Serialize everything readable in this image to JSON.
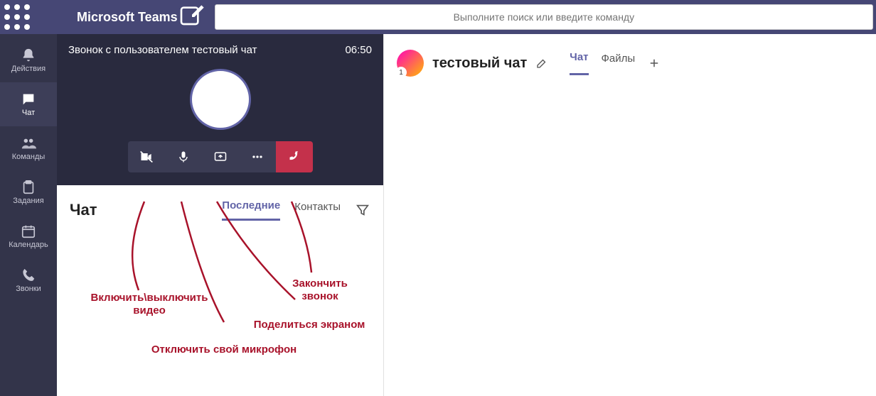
{
  "app": {
    "title": "Microsoft Teams"
  },
  "search": {
    "placeholder": "Выполните поиск или введите команду"
  },
  "rail": {
    "items": [
      {
        "label": "Действия",
        "icon": "bell"
      },
      {
        "label": "Чат",
        "icon": "chat",
        "active": true
      },
      {
        "label": "Команды",
        "icon": "teams"
      },
      {
        "label": "Задания",
        "icon": "assignments"
      },
      {
        "label": "Календарь",
        "icon": "calendar"
      },
      {
        "label": "Звонки",
        "icon": "calls"
      }
    ]
  },
  "call": {
    "title": "Звонок с пользователем тестовый чат",
    "duration": "06:50",
    "buttons": [
      "camera-off",
      "mic",
      "share-screen",
      "more",
      "hangup"
    ]
  },
  "chatlist": {
    "title": "Чат",
    "tabs": [
      {
        "label": "Последние",
        "active": true
      },
      {
        "label": "Контакты"
      }
    ]
  },
  "annotations": {
    "video": "Включить\\выключить\nвидео",
    "mic": "Отключить свой микрофон",
    "share": "Поделиться экраном",
    "hangup": "Закончить\nзвонок"
  },
  "main": {
    "chat_name": "тестовый чат",
    "presence_count": "1",
    "tabs": [
      {
        "label": "Чат",
        "active": true
      },
      {
        "label": "Файлы"
      }
    ]
  }
}
